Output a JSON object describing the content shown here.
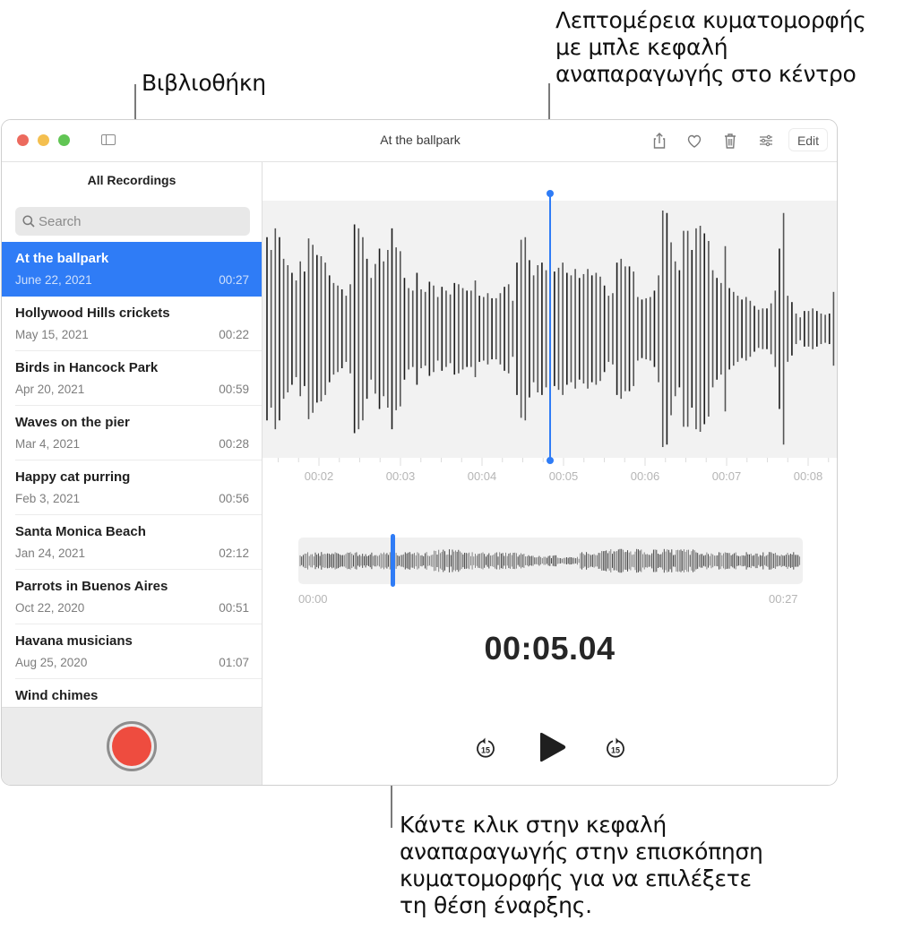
{
  "callouts": {
    "library": "Βιβλιοθήκη",
    "detail_waveform": [
      "Λεπτομέρεια κυματομορφής",
      "με μπλε κεφαλή",
      "αναπαραγωγής στο κέντρο"
    ],
    "overview_playhead": [
      "Κάντε κλικ στην κεφαλή",
      "αναπαραγωγής στην επισκόπηση",
      "κυματομορφής για να επιλέξετε",
      "τη θέση έναρξης."
    ]
  },
  "window": {
    "title": "At the ballpark",
    "toolbar": {
      "icons": [
        "sidebar-toggle-icon",
        "share-icon",
        "heart-icon",
        "trash-icon",
        "sliders-icon"
      ],
      "edit_label": "Edit"
    }
  },
  "sidebar": {
    "heading": "All Recordings",
    "search_placeholder": "Search",
    "recordings": [
      {
        "name": "At the ballpark",
        "date": "June 22, 2021",
        "duration": "00:27",
        "selected": true
      },
      {
        "name": "Hollywood Hills crickets",
        "date": "May 15, 2021",
        "duration": "00:22"
      },
      {
        "name": "Birds in Hancock Park",
        "date": "Apr 20, 2021",
        "duration": "00:59"
      },
      {
        "name": "Waves on the pier",
        "date": "Mar 4, 2021",
        "duration": "00:28"
      },
      {
        "name": "Happy cat purring",
        "date": "Feb 3, 2021",
        "duration": "00:56"
      },
      {
        "name": "Santa Monica Beach",
        "date": "Jan 24, 2021",
        "duration": "02:12"
      },
      {
        "name": "Parrots in Buenos Aires",
        "date": "Oct 22, 2020",
        "duration": "00:51"
      },
      {
        "name": "Havana musicians",
        "date": "Aug 25, 2020",
        "duration": "01:07"
      },
      {
        "name": "Wind chimes",
        "date": "",
        "duration": ""
      }
    ],
    "record_button_color": "#ee4c3f"
  },
  "player": {
    "accent_color": "#2f7cf6",
    "tick_labels": [
      "00:02",
      "00:03",
      "00:04",
      "00:05",
      "00:06",
      "00:07",
      "00:08"
    ],
    "detail_amplitudes": [
      0.72,
      0.62,
      0.79,
      0.72,
      0.55,
      0.5,
      0.44,
      0.38,
      0.53,
      0.45,
      0.71,
      0.66,
      0.58,
      0.57,
      0.52,
      0.42,
      0.36,
      0.34,
      0.31,
      0.26,
      0.35,
      0.82,
      0.79,
      0.72,
      0.55,
      0.4,
      0.51,
      0.63,
      0.53,
      0.62,
      0.79,
      0.64,
      0.61,
      0.4,
      0.32,
      0.3,
      0.44,
      0.31,
      0.29,
      0.37,
      0.34,
      0.25,
      0.33,
      0.3,
      0.27,
      0.36,
      0.35,
      0.32,
      0.3,
      0.3,
      0.38,
      0.26,
      0.25,
      0.28,
      0.24,
      0.24,
      0.28,
      0.33,
      0.35,
      0.22,
      0.52,
      0.7,
      0.72,
      0.54,
      0.42,
      0.5,
      0.52,
      0.46,
      0.48,
      0.45,
      0.48,
      0.52,
      0.44,
      0.42,
      0.47,
      0.4,
      0.43,
      0.47,
      0.42,
      0.44,
      0.41,
      0.34,
      0.26,
      0.28,
      0.52,
      0.55,
      0.49,
      0.49,
      0.45,
      0.25,
      0.23,
      0.24,
      0.25,
      0.3,
      0.42,
      0.93,
      0.91,
      0.68,
      0.53,
      0.46,
      0.77,
      0.77,
      0.62,
      0.79,
      0.81,
      0.75,
      0.69,
      0.46,
      0.4,
      0.36,
      0.65,
      0.32,
      0.29,
      0.26,
      0.23,
      0.25,
      0.22,
      0.18,
      0.15,
      0.16,
      0.16,
      0.2,
      0.3,
      0.63,
      0.91,
      0.26,
      0.21,
      0.12,
      0.09,
      0.14,
      0.14,
      0.16,
      0.14,
      0.12,
      0.11,
      0.12,
      0.29
    ],
    "overview_amplitude_seed": 27,
    "start_label": "00:00",
    "end_label": "00:27",
    "current_time": "00:05.04",
    "playhead_progress": 0.187,
    "controls": {
      "skip_back": "15",
      "skip_forward": "15"
    }
  }
}
